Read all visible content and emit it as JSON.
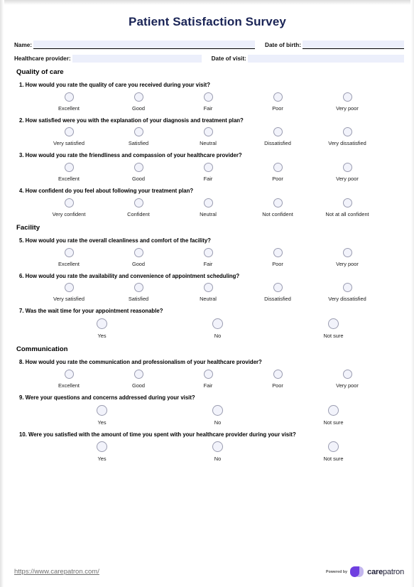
{
  "document": {
    "title": "Patient Satisfaction Survey"
  },
  "patient_info": {
    "name_label": "Name:",
    "name_value": "",
    "dob_label": "Date of birth:",
    "dob_value": "",
    "provider_label": "Healthcare provider:",
    "provider_value": "",
    "visit_label": "Date of visit:",
    "visit_value": ""
  },
  "sections": [
    {
      "heading": "Quality of care",
      "questions": [
        {
          "text": "1. How would you rate the quality of care you received during your visit?",
          "scale": "five",
          "options": [
            "Excellent",
            "Good",
            "Fair",
            "Poor",
            "Very poor"
          ]
        },
        {
          "text": "2. How satisfied were you with the explanation of your diagnosis and treatment plan?",
          "scale": "five",
          "options": [
            "Very satisfied",
            "Satisfied",
            "Neutral",
            "Dissatisfied",
            "Very dissatisfied"
          ]
        },
        {
          "text": "3. How would you rate the friendliness and compassion of your healthcare provider?",
          "scale": "five",
          "options": [
            "Excellent",
            "Good",
            "Fair",
            "Poor",
            "Very poor"
          ]
        },
        {
          "text": "4. How confident do you feel about following your treatment plan?",
          "scale": "five",
          "options": [
            "Very confident",
            "Confident",
            "Neutral",
            "Not confident",
            "Not at all confident"
          ]
        }
      ]
    },
    {
      "heading": "Facility",
      "questions": [
        {
          "text": "5. How would you rate the overall cleanliness and comfort of the facility?",
          "scale": "five",
          "options": [
            "Excellent",
            "Good",
            "Fair",
            "Poor",
            "Very poor"
          ]
        },
        {
          "text": "6. How would you rate the availability and convenience of appointment scheduling?",
          "scale": "five",
          "options": [
            "Very satisfied",
            "Satisfied",
            "Neutral",
            "Dissatisfied",
            "Very dissatisfied"
          ]
        },
        {
          "text": "7. Was the wait time for your appointment reasonable?",
          "scale": "three",
          "options": [
            "Yes",
            "No",
            "Not sure"
          ]
        }
      ]
    },
    {
      "heading": "Communication",
      "questions": [
        {
          "text": "8. How would you rate the communication and professionalism of your healthcare provider?",
          "scale": "five",
          "options": [
            "Excellent",
            "Good",
            "Fair",
            "Poor",
            "Very poor"
          ]
        },
        {
          "text": "9. Were your questions and concerns addressed during your visit?",
          "scale": "three",
          "options": [
            "Yes",
            "No",
            "Not sure"
          ]
        },
        {
          "text": "10. Were you satisfied with the amount of time you spent with your healthcare provider during your visit?",
          "scale": "three",
          "options": [
            "Yes",
            "No",
            "Not sure"
          ]
        }
      ]
    }
  ],
  "footer": {
    "url": "https://www.carepatron.com/",
    "powered_by": "Powered by",
    "brand_bold": "care",
    "brand_light": "patron",
    "brand_purple": "#6f3fe0",
    "brand_lavender": "#c3b6ee"
  },
  "theme": {
    "title_color": "#1a2456",
    "field_fill": "#eceffb",
    "radio_fill": "#f2f3fb",
    "radio_border": "#9a9cb0"
  }
}
